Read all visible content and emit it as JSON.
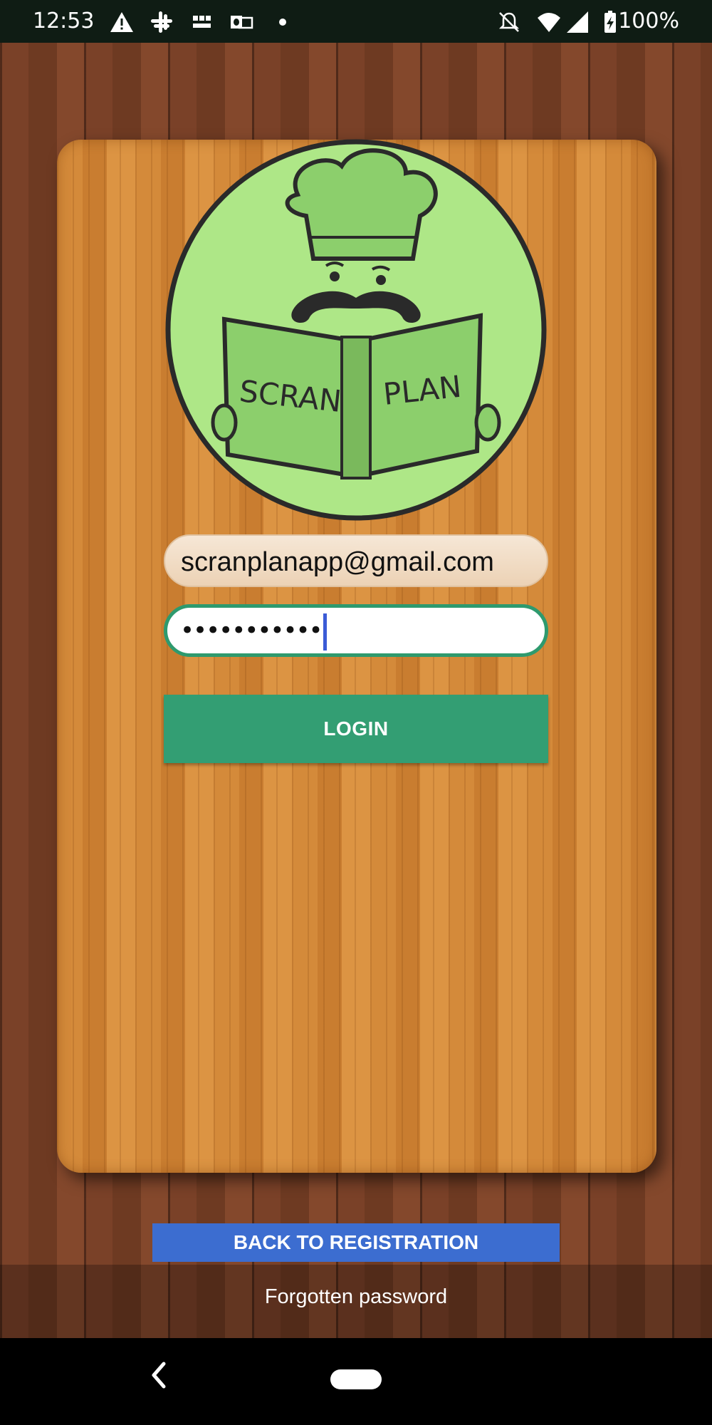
{
  "status_bar": {
    "time": "12:53",
    "icons": [
      "warning-icon",
      "slack-icon",
      "bbc-news-icon",
      "outlook-icon",
      "dot-icon",
      "notifications-off-icon",
      "wifi-icon",
      "cell-signal-icon",
      "battery-charging-icon"
    ],
    "battery": "100%"
  },
  "logo": {
    "left_text": "SCRAN",
    "right_text": "PLAN",
    "colors": {
      "background": "#aee787",
      "outline": "#2a2a2a",
      "book": "#8ccf6c"
    }
  },
  "login_form": {
    "email_value": "scranplanapp@gmail.com",
    "password_value": "•••••••••••",
    "login_label": "LOGIN"
  },
  "footer": {
    "back_label": "BACK TO REGISTRATION",
    "forgot_label": "Forgotten password"
  },
  "colors": {
    "login_button": "#339e73",
    "back_button": "#3c6dd0",
    "focus_border": "#2e9a6e"
  },
  "nav_bar": {
    "icons": [
      "back-chevron-icon",
      "home-pill-icon"
    ]
  }
}
